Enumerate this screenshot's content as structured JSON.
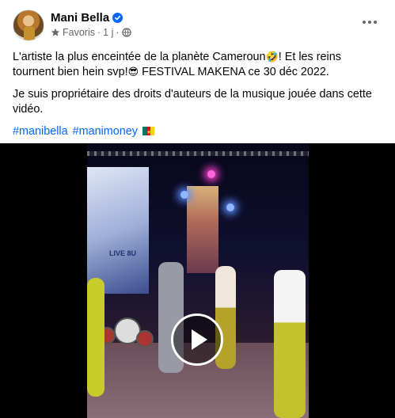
{
  "post": {
    "author": "Mani Bella",
    "audience_label": "Favoris",
    "time": "1 j",
    "separator": "·",
    "text_line1": "L'artiste la plus enceintée de la planète Cameroun",
    "emoji_1": "🤣",
    "text_line1b": "! Et les reins tournent bien hein svp!",
    "emoji_2": "😎",
    "text_line1c": " FESTIVAL MAKENA ce 30 déc 2022.",
    "text_line2": "Je suis propriétaire des droits d'auteurs de la musique jouée dans cette vidéo.",
    "hashtags": [
      "#manibella",
      "#manimoney"
    ]
  },
  "video": {
    "banner_text": "LIVE 8U"
  },
  "colors": {
    "link": "#0866ff",
    "verified": "#0866ff",
    "meta": "#65676b"
  },
  "icons": {
    "verified": "verified-badge-icon",
    "favorites": "star-icon",
    "audience": "globe-icon",
    "more": "more-options-icon",
    "play": "play-icon",
    "flag": "cameroon-flag-icon"
  }
}
